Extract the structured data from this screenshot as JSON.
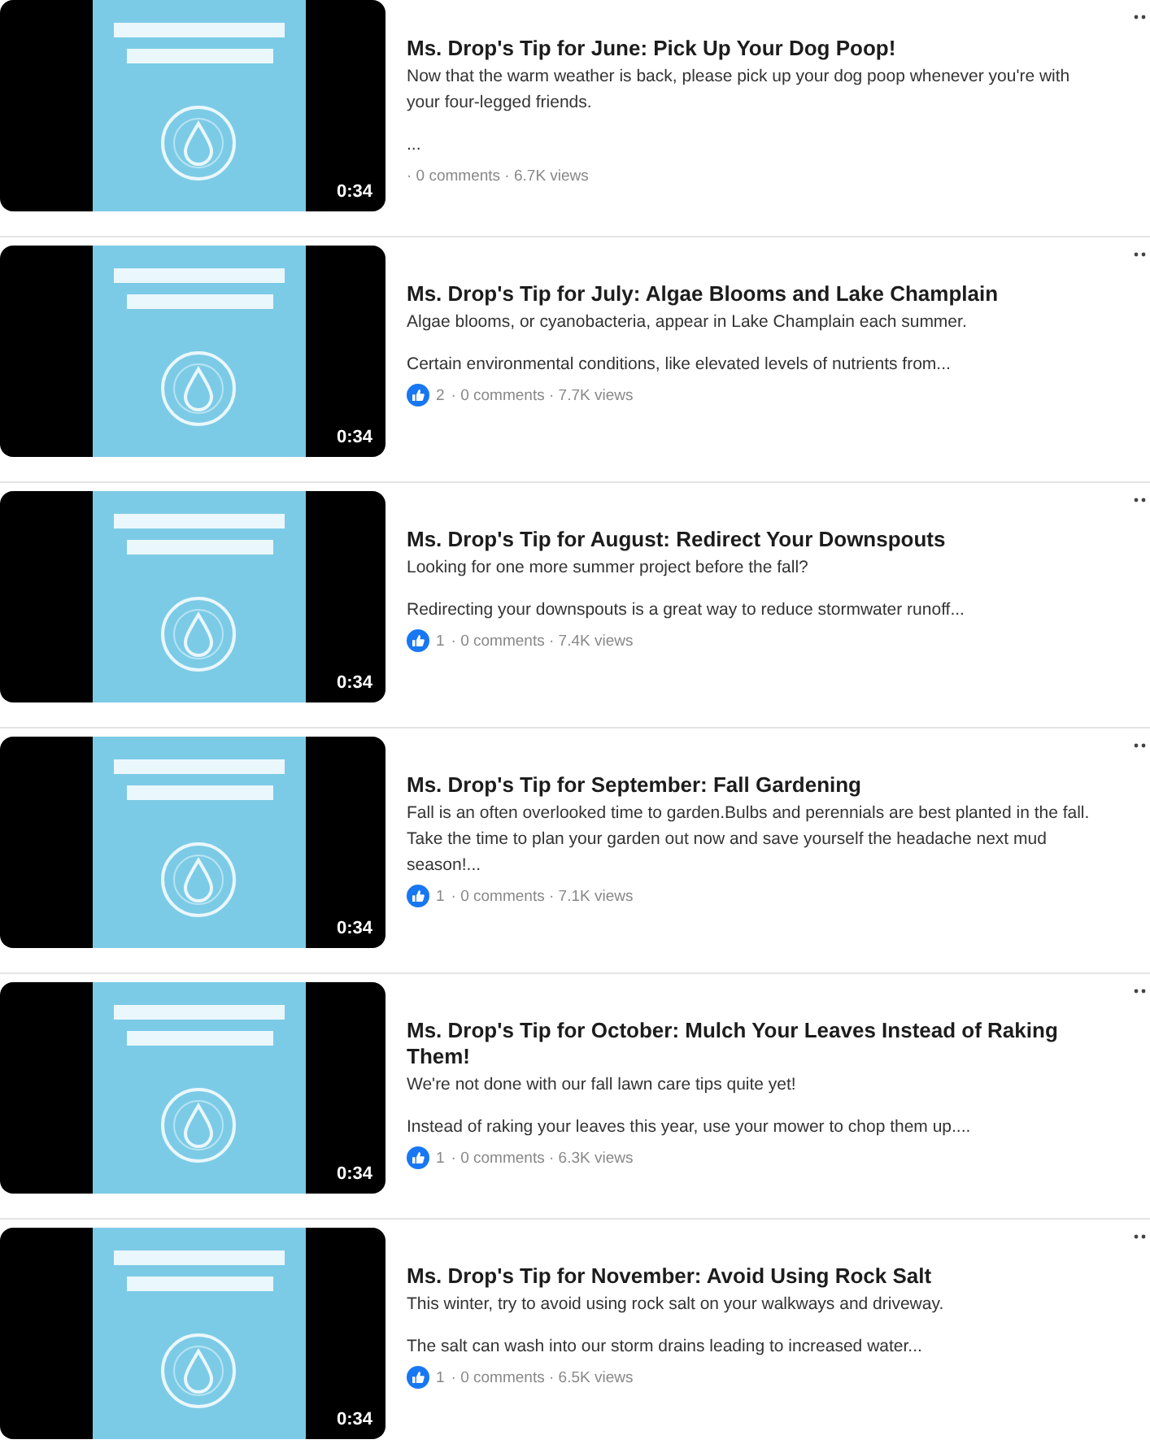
{
  "videos": [
    {
      "duration": "0:34",
      "title": "Ms. Drop's Tip for June: Pick Up Your Dog Poop!",
      "description": [
        "Now that the warm weather is back, please pick up your dog poop whenever you're with your four-legged friends.",
        "..."
      ],
      "stats": "· 0 comments · 6.7K views"
    },
    {
      "duration": "0:34",
      "title": "Ms. Drop's Tip for July: Algae Blooms and Lake Champlain",
      "description": [
        "Algae blooms, or cyanobacteria, appear in Lake Champlain each summer.",
        "Certain environmental conditions, like elevated levels of nutrients from..."
      ],
      "reactions": "2",
      "stats": "· 0 comments · 7.7K views"
    },
    {
      "duration": "0:34",
      "title": "Ms. Drop's Tip for August: Redirect Your Downspouts",
      "description": [
        "Looking for one more summer project before the fall?",
        "Redirecting your downspouts is a great way to reduce stormwater runoff..."
      ],
      "reactions": "1",
      "stats": "· 0 comments · 7.4K views"
    },
    {
      "duration": "0:34",
      "title": "Ms. Drop's Tip for September: Fall Gardening",
      "description": [
        "Fall is an often overlooked time to garden.Bulbs and perennials are best planted in the fall. Take the time to plan your garden out now and save yourself the headache next mud season!..."
      ],
      "reactions": "1",
      "stats": "· 0 comments · 7.1K views"
    },
    {
      "duration": "0:34",
      "title": "Ms. Drop's Tip for October: Mulch Your Leaves Instead of Raking Them!",
      "description": [
        "We're not done with our fall lawn care tips quite yet!",
        "Instead of raking your leaves this year, use your mower to chop them up...."
      ],
      "reactions": "1",
      "stats": "· 0 comments · 6.3K views"
    },
    {
      "duration": "0:34",
      "title": "Ms. Drop's Tip for November: Avoid Using Rock Salt",
      "description": [
        "This winter, try to avoid using rock salt on your walkways and driveway.",
        "The salt can wash into our storm drains leading to increased water..."
      ],
      "reactions": "1",
      "stats": "· 0 comments · 6.5K views"
    }
  ]
}
